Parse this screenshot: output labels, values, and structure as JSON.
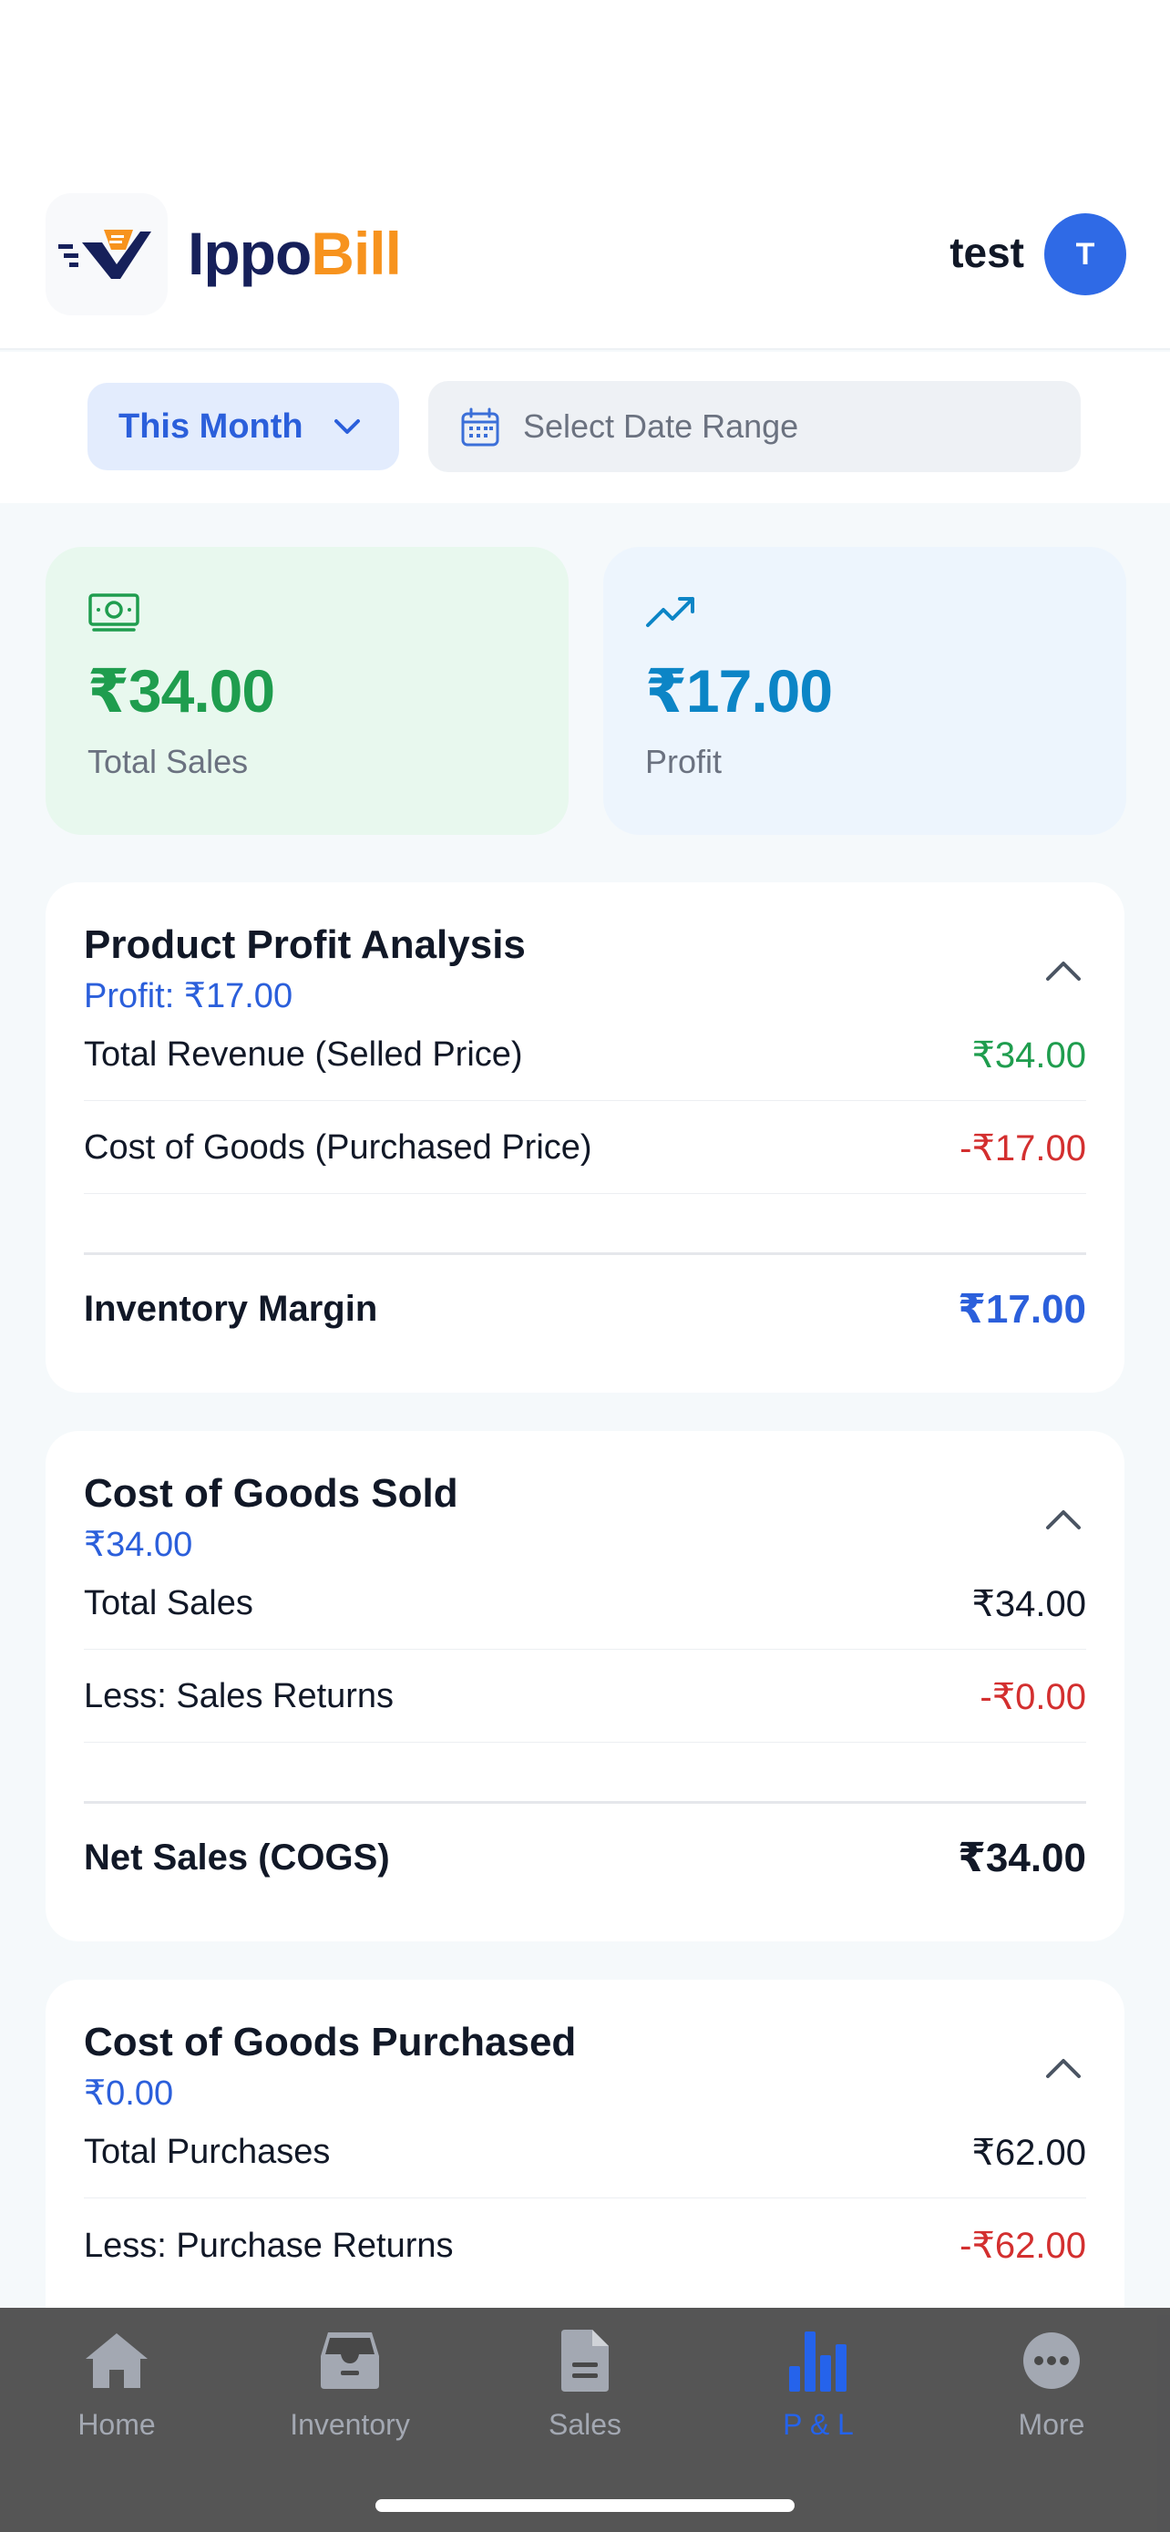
{
  "app": {
    "brand_part1": "Ippo",
    "brand_part2": "Bill",
    "user_name": "test",
    "avatar_initial": "T"
  },
  "filters": {
    "period_label": "This Month",
    "date_range_placeholder": "Select Date Range"
  },
  "stats": [
    {
      "value": "₹34.00",
      "label": "Total Sales",
      "icon": "cash-icon"
    },
    {
      "value": "₹17.00",
      "label": "Profit",
      "icon": "trending-up-icon"
    }
  ],
  "sections": [
    {
      "title": "Product Profit Analysis",
      "subtitle": "Profit: ₹17.00",
      "rows": [
        {
          "label": "Total Revenue (Selled Price)",
          "value": "₹34.00"
        },
        {
          "label": "Cost of Goods (Purchased Price)",
          "value": "-₹17.00"
        }
      ],
      "total": {
        "label": "Inventory Margin",
        "value": "₹17.00"
      }
    },
    {
      "title": "Cost of Goods Sold",
      "subtitle": "₹34.00",
      "rows": [
        {
          "label": "Total Sales",
          "value": "₹34.00"
        },
        {
          "label": "Less: Sales Returns",
          "value": "-₹0.00"
        }
      ],
      "total": {
        "label": "Net Sales (COGS)",
        "value": "₹34.00"
      }
    },
    {
      "title": "Cost of Goods Purchased",
      "subtitle": "₹0.00",
      "rows": [
        {
          "label": "Total Purchases",
          "value": "₹62.00"
        },
        {
          "label": "Less: Purchase Returns",
          "value": "-₹62.00"
        }
      ]
    }
  ],
  "tabs": [
    {
      "label": "Home",
      "icon": "home-icon"
    },
    {
      "label": "Inventory",
      "icon": "inventory-icon"
    },
    {
      "label": "Sales",
      "icon": "document-icon"
    },
    {
      "label": "P & L",
      "icon": "bar-chart-icon",
      "active": true
    },
    {
      "label": "More",
      "icon": "more-icon"
    }
  ],
  "colors": {
    "accent": "#2b5fdb",
    "brand_navy": "#16205a",
    "brand_orange": "#f7931e",
    "positive": "#1f9d4e",
    "negative": "#d32f2f"
  }
}
